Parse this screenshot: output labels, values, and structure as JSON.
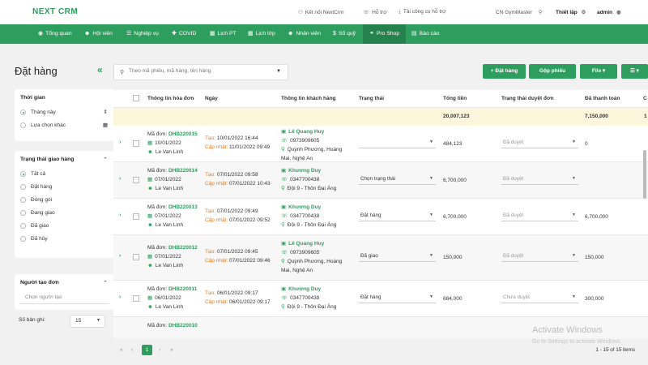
{
  "app": {
    "logo": "NEXT CRM"
  },
  "topbar": {
    "connect": "Kết nối NextCrm",
    "support": "Hỗ trợ",
    "download": "Tải công cụ hỗ trợ",
    "branch": "CN GymMaster",
    "settings": "Thiết lập",
    "user": "admin"
  },
  "nav": [
    {
      "label": "Tổng quan",
      "icon": "dashboard-icon"
    },
    {
      "label": "Hội viên",
      "icon": "members-icon"
    },
    {
      "label": "Nghiệp vụ",
      "icon": "business-icon"
    },
    {
      "label": "COVID",
      "icon": "covid-icon"
    },
    {
      "label": "Lịch PT",
      "icon": "calendar-icon"
    },
    {
      "label": "Lịch lớp",
      "icon": "calendar-icon"
    },
    {
      "label": "Nhân viên",
      "icon": "staff-icon"
    },
    {
      "label": "Sổ quỹ",
      "icon": "dollar-icon"
    },
    {
      "label": "Pro Shop",
      "icon": "shop-icon"
    },
    {
      "label": "Báo cáo",
      "icon": "report-icon"
    }
  ],
  "page": {
    "title": "Đặt hàng",
    "collapse": "«"
  },
  "filters": {
    "time": {
      "title": "Thời gian",
      "options": [
        "Tháng này",
        "Lựa chọn khác"
      ]
    },
    "status": {
      "title": "Trạng thái giao hàng",
      "options": [
        "Tất cả",
        "Đặt hàng",
        "Đóng gói",
        "Đang giao",
        "Đã giao",
        "Đã hủy"
      ]
    },
    "creator": {
      "title": "Người tạo đơn",
      "placeholder": "Chọn người tạo"
    },
    "perpage": {
      "label": "Số bản ghi:",
      "value": "15"
    }
  },
  "search": {
    "placeholder": "Theo mã phiếu, mã hàng, tên hàng"
  },
  "buttons": {
    "order": "+ Đặt hàng",
    "merge": "Gộp phiếu",
    "file": "File ▾",
    "menu": "☰ ▾"
  },
  "table": {
    "headers": [
      "Thông tin hóa đơn",
      "Ngày",
      "Thông tin khách hàng",
      "Trạng thái",
      "Tổng tiền",
      "Trạng thái duyệt đơn",
      "Đã thanh toán",
      "C"
    ],
    "totals": {
      "total": "20,007,123",
      "paid": "7,150,000",
      "extra": "1"
    },
    "rows": [
      {
        "code_label": "Mã đơn:",
        "code": "DHB220015",
        "date": "10/01/2022",
        "staff": "Le Van Linh",
        "created_label": "Tạo:",
        "created": "10/01/2022 16:44",
        "updated_label": "Cập nhật:",
        "updated": "11/01/2022 09:49",
        "customer": "Lê Quang Huy",
        "phone": "0973909605",
        "addr1": "Quỳnh Phương, Hoàng",
        "addr2": "Mai, Nghệ An",
        "status": "",
        "total": "484,123",
        "approval": "Đã duyệt",
        "paid": "0"
      },
      {
        "code_label": "Mã đơn:",
        "code": "DHB220014",
        "date": "07/01/2022",
        "staff": "Le Van Linh",
        "created_label": "Tạo:",
        "created": "07/01/2022 09:58",
        "updated_label": "Cập nhật:",
        "updated": "07/01/2022 10:43",
        "customer": "Khương Duy",
        "phone": "0347700438",
        "addr1": "Đội 9 - Thôn Đại Áng",
        "addr2": "",
        "status": "Chọn trạng thái",
        "total": "6,700,000",
        "approval": "Đã duyệt",
        "paid": ""
      },
      {
        "code_label": "Mã đơn:",
        "code": "DHB220013",
        "date": "07/01/2022",
        "staff": "Le Van Linh",
        "created_label": "Tạo:",
        "created": "07/01/2022 09:49",
        "updated_label": "Cập nhật:",
        "updated": "07/01/2022 09:52",
        "customer": "Khương Duy",
        "phone": "0347700438",
        "addr1": "Đội 9 - Thôn Đại Áng",
        "addr2": "",
        "status": "Đặt hàng",
        "total": "6,700,000",
        "approval": "Đã duyệt",
        "paid": "6,700,000"
      },
      {
        "code_label": "Mã đơn:",
        "code": "DHB220012",
        "date": "07/01/2022",
        "staff": "Le Van Linh",
        "created_label": "Tạo:",
        "created": "07/01/2022 09:45",
        "updated_label": "Cập nhật:",
        "updated": "07/01/2022 09:46",
        "customer": "Lê Quang Huy",
        "phone": "0973909605",
        "addr1": "Quỳnh Phương, Hoàng",
        "addr2": "Mai, Nghệ An",
        "status": "Đã giao",
        "total": "150,000",
        "approval": "Đã duyệt",
        "paid": "150,000"
      },
      {
        "code_label": "Mã đơn:",
        "code": "DHB220011",
        "date": "06/01/2022",
        "staff": "Le Van Linh",
        "created_label": "Tạo:",
        "created": "06/01/2022 09:17",
        "updated_label": "Cập nhật:",
        "updated": "06/01/2022 09:17",
        "customer": "Khương Duy",
        "phone": "0347700438",
        "addr1": "Đội 9 - Thôn Đại Áng",
        "addr2": "",
        "status": "Đặt hàng",
        "total": "684,000",
        "approval": "Chưa duyệt",
        "paid": "300,000"
      },
      {
        "code_label": "Mã đơn:",
        "code": "DHB220010",
        "date": "",
        "staff": "",
        "created_label": "",
        "created": "",
        "updated_label": "",
        "updated": "",
        "customer": "",
        "phone": "",
        "addr1": "",
        "addr2": "",
        "status": "",
        "total": "",
        "approval": "",
        "paid": ""
      }
    ]
  },
  "pager": {
    "first": "«",
    "prev": "‹",
    "page": "1",
    "next": "›",
    "last": "»",
    "count": "1 - 15 of 15 items"
  },
  "watermark": {
    "line1": "Activate Windows",
    "line2": "Go to Settings to activate Windows."
  },
  "colors": {
    "brand": "#2e9e5e",
    "highlight": "#fcf6dc"
  }
}
